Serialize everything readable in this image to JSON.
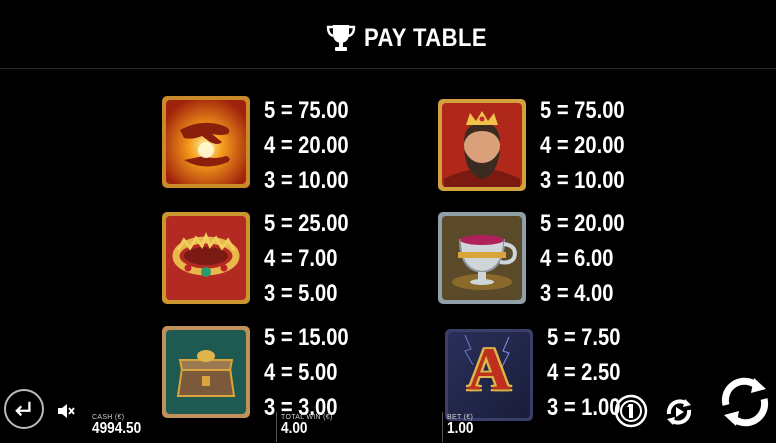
{
  "header": {
    "title": "PAY TABLE",
    "icon": "trophy-icon"
  },
  "paytable": [
    {
      "symbol": "hands-symbol",
      "pays": [
        "5 = 75.00",
        "4 = 20.00",
        "3 = 10.00"
      ]
    },
    {
      "symbol": "king-symbol",
      "pays": [
        "5 = 75.00",
        "4 = 20.00",
        "3 = 10.00"
      ]
    },
    {
      "symbol": "crown-symbol",
      "pays": [
        "5 = 25.00",
        "4 = 7.00",
        "3 = 5.00"
      ]
    },
    {
      "symbol": "goblet-symbol",
      "pays": [
        "5 = 20.00",
        "4 = 6.00",
        "3 = 4.00"
      ]
    },
    {
      "symbol": "chest-symbol",
      "pays": [
        "5 = 15.00",
        "4 = 5.00",
        "3 = 3.00"
      ]
    },
    {
      "symbol": "letter-a-symbol",
      "letter": "A",
      "pays": [
        "5 = 7.50",
        "4 = 2.50",
        "3 = 1.00"
      ]
    }
  ],
  "footer": {
    "cash": {
      "label": "CASH (€)",
      "value": "4994.50"
    },
    "total_win": {
      "label": "TOTAL WIN (€)",
      "value": "4.00"
    },
    "bet": {
      "label": "BET (€)",
      "value": "1.00"
    }
  },
  "colors": {
    "background": "#000000",
    "text": "#ffffff",
    "gold": "#d9a53a"
  }
}
